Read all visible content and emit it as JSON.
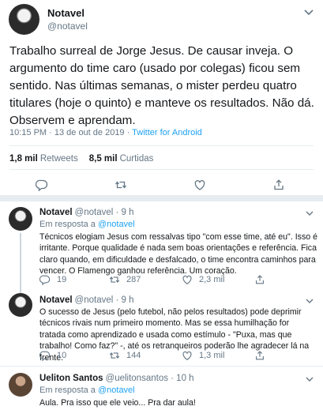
{
  "main_tweet": {
    "name": "Notavel",
    "handle": "@notavel",
    "text": "Trabalho surreal de Jorge Jesus. De causar inveja. O argumento do time caro (usado por colegas) ficou sem sentido. Nas últimas semanas, o mister perdeu quatro titulares (hoje o quinto) e manteve os resultados. Não dá. Observem e aprendam.",
    "timestamp": "10:15 PM · 13 de out de 2019 · ",
    "source": "Twitter for Android",
    "retweets_count": "1,8 mil",
    "retweets_label": "Retweets",
    "likes_count": "8,5 mil",
    "likes_label": "Curtidas"
  },
  "replies": [
    {
      "name": "Notavel",
      "handle_time": "@notavel · 9 h",
      "reply_prefix": "Em resposta a ",
      "reply_to": "@notavel",
      "text": "Técnicos elogiam Jesus com ressalvas tipo \"com esse time, até eu\". Isso é irritante. Porque qualidade é nada sem boas orientações e referência. Fica claro quando, em dificuldade e desfalcado, o time encontra caminhos para vencer. O Flamengo ganhou referência. Um coração.",
      "replies": "19",
      "retweets": "287",
      "likes": "2,3 mil"
    },
    {
      "name": "Notavel",
      "handle_time": "@notavel · 9 h",
      "text": "O sucesso de Jesus (pelo futebol, não pelos resultados) pode deprimir técnicos rivais num primeiro momento. Mas se essa humilhação for tratada como aprendizado e usada como estímulo - \"Puxa, mas que trabalho! Como faz?\" -, até os retranqueiros poderão lhe agradecer lá na frente.",
      "replies": "10",
      "retweets": "144",
      "likes": "1,3 mil"
    },
    {
      "name": "Ueliton Santos",
      "handle_time": "@uelitonsantos · 10 h",
      "reply_prefix": "Em resposta a ",
      "reply_to": "@notavel",
      "text": "Aula. Pra isso que ele veio... Pra dar aula!"
    }
  ],
  "colors": {
    "accent": "#1da1f2",
    "secondary_text": "#657786",
    "divider": "#e6ecf0"
  }
}
